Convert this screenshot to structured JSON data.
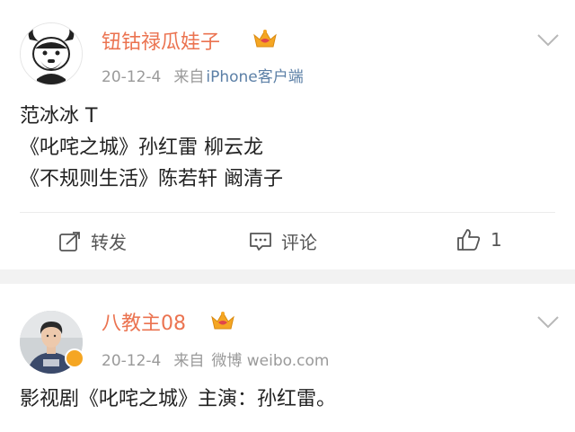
{
  "posts": [
    {
      "username": "钮钴禄瓜娃子",
      "date": "20-12-4",
      "from_label": "来自",
      "source": "iPhone客户端",
      "lines": [
        "范冰冰 T",
        "《叱咤之城》孙红雷 柳云龙",
        "《不规则生活》陈若轩 阚清子"
      ],
      "actions": {
        "repost_label": "转发",
        "comment_label": "评论",
        "like_count": "1"
      },
      "avatar_icon": "cartoon-bull-avatar-icon",
      "crown_icon": "vip-crown-icon"
    },
    {
      "username": "八教主08",
      "date": "20-12-4",
      "from_label": "来自",
      "source": "微博 weibo.com",
      "lines": [
        "影视剧《叱咤之城》主演：孙红雷。"
      ],
      "avatar_icon": "user-photo-avatar-icon",
      "crown_icon": "vip-crown-icon"
    }
  ],
  "colors": {
    "username": "#eb7350",
    "meta": "#9a9a9a",
    "source_link": "#5b7fa6",
    "crown": "#f5a623",
    "separator": "#f2f2f2"
  }
}
